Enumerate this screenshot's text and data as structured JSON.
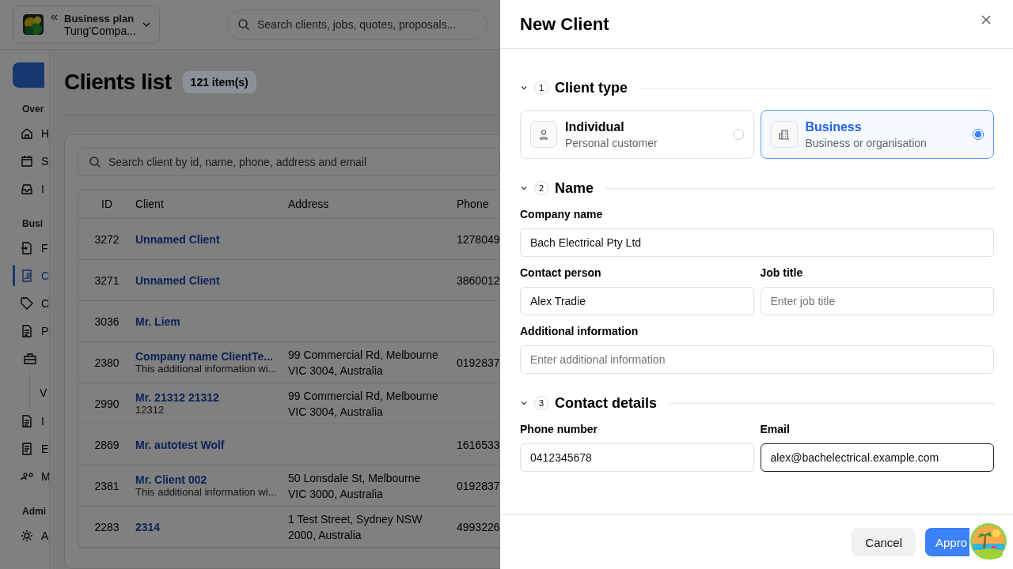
{
  "header": {
    "plan_label": "Business plan",
    "company": "Tung'Compa...",
    "search_placeholder": "Search clients, jobs, quotes, proposals..."
  },
  "sidebar": {
    "sections": [
      {
        "label": "Over",
        "items": [
          {
            "label": "H",
            "selected": false
          },
          {
            "label": "S",
            "selected": false
          },
          {
            "label": "I",
            "selected": false
          }
        ]
      },
      {
        "label": "Busi",
        "items": [
          {
            "label": "F",
            "selected": false
          },
          {
            "label": "C",
            "selected": true
          },
          {
            "label": "C",
            "selected": false
          },
          {
            "label": "P",
            "selected": false
          },
          {
            "selected": false,
            "children": [
              {
                "label": "V"
              }
            ]
          },
          {
            "label": "I",
            "selected": false
          },
          {
            "label": "E",
            "selected": false
          },
          {
            "label": "M",
            "selected": false
          }
        ]
      },
      {
        "label": "Admi",
        "items": [
          {
            "label": "A",
            "selected": false
          }
        ]
      }
    ]
  },
  "page": {
    "title": "Clients list",
    "count": "121 item(s)",
    "search_placeholder": "Search client by id, name, phone, address and email",
    "columns": [
      "ID",
      "Client",
      "Address",
      "Phone"
    ],
    "rows": [
      {
        "id": "3272",
        "client": "Unnamed Client",
        "phone": "1278049"
      },
      {
        "id": "3271",
        "client": "Unnamed Client",
        "phone": "3860012"
      },
      {
        "id": "3036",
        "client": "Mr. Liem"
      },
      {
        "id": "2380",
        "client": "Company name ClientTe...",
        "note": "This additional information wi...",
        "address_lines": [
          "99 Commercial Rd, Melbourne",
          "VIC 3004, Australia"
        ],
        "phone": "0192837"
      },
      {
        "id": "2990",
        "client": "Mr. 21312 21312",
        "note": "12312",
        "address_lines": [
          "99 Commercial Rd, Melbourne",
          "VIC 3004, Australia"
        ]
      },
      {
        "id": "2869",
        "client": "Mr. autotest Wolf",
        "phone": "1616533"
      },
      {
        "id": "2381",
        "client": "Mr. Client 002",
        "note": "This additional information wi...",
        "address_lines": [
          "50 Lonsdale St, Melbourne",
          "VIC 3000, Australia"
        ],
        "phone": "0192837"
      },
      {
        "id": "2283",
        "client": "2314",
        "address_lines": [
          "1 Test Street, Sydney NSW",
          "2000, Australia"
        ],
        "phone": "4993226"
      }
    ]
  },
  "drawer": {
    "title": "New Client",
    "client_type": {
      "number": "1",
      "title": "Client type",
      "expanded": true,
      "options": [
        {
          "label": "Individual",
          "description": "Personal customer",
          "selected": false
        },
        {
          "label": "Business",
          "description": "Business or organisation",
          "selected": true
        }
      ]
    },
    "form_sections": [
      {
        "number": "2",
        "title": "Name",
        "expanded": true,
        "rows": [
          [
            {
              "label": "Company name",
              "value": "Bach Electrical Pty Ltd",
              "focused": false
            }
          ],
          [
            {
              "label": "Contact person",
              "value": "Alex Tradie",
              "focused": false
            },
            {
              "label": "Job title",
              "placeholder": "Enter job title",
              "focused": false
            }
          ],
          [
            {
              "label": "Additional information",
              "placeholder": "Enter additional information",
              "focused": false
            }
          ]
        ]
      },
      {
        "number": "3",
        "title": "Contact details",
        "expanded": true,
        "rows": [
          [
            {
              "label": "Phone number",
              "value": "0412345678",
              "focused": false
            },
            {
              "label": "Email",
              "value": "alex@bachelectrical.example.com",
              "focused": true
            }
          ]
        ]
      }
    ],
    "buttons": [
      {
        "label": "Cancel",
        "kind": "secondary"
      },
      {
        "label": "Appro",
        "kind": "primary"
      }
    ]
  }
}
